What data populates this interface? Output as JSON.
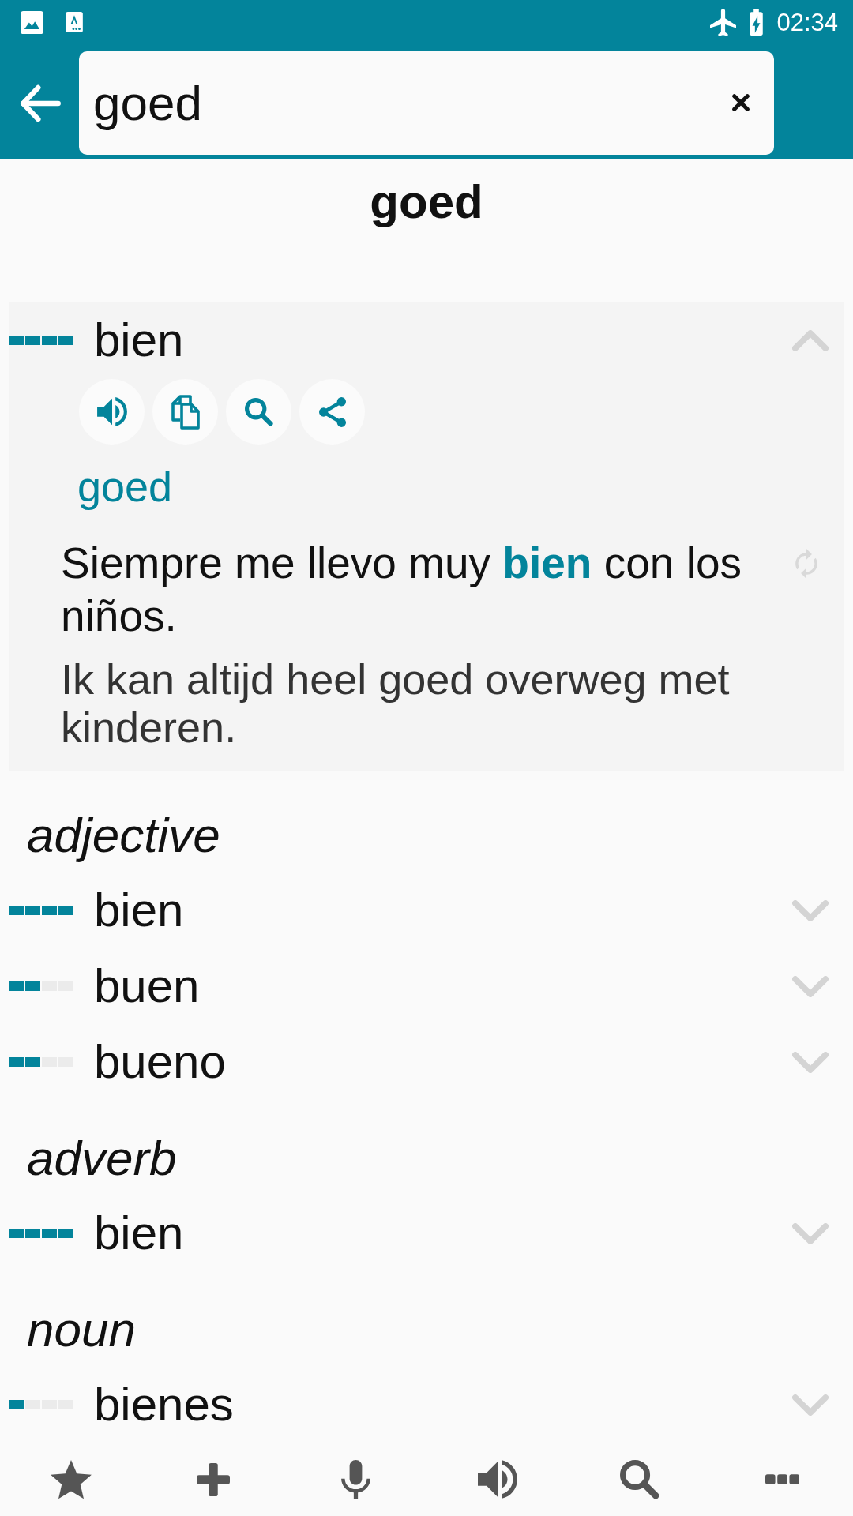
{
  "status_bar": {
    "time": "02:34"
  },
  "search": {
    "value": "goed"
  },
  "headword": "goed",
  "sections": [
    {
      "entries": [
        {
          "word": "bien",
          "level": 1,
          "expanded": true,
          "source": "goed",
          "example": "Siempre me llevo muy **bien** con los niños.",
          "example_translation": "Ik kan altijd heel goed overweg met kinderen."
        }
      ]
    },
    {
      "part_of_speech": "adjective",
      "entries": [
        {
          "word": "bien",
          "level": 1,
          "expanded": false
        },
        {
          "word": "buen",
          "level": 0.5,
          "expanded": false
        },
        {
          "word": "bueno",
          "level": 0.5,
          "expanded": false
        }
      ]
    },
    {
      "part_of_speech": "adverb",
      "entries": [
        {
          "word": "bien",
          "level": 1,
          "expanded": false
        }
      ]
    },
    {
      "part_of_speech": "noun",
      "entries": [
        {
          "word": "bienes",
          "level": 0.25,
          "expanded": false
        }
      ]
    }
  ]
}
